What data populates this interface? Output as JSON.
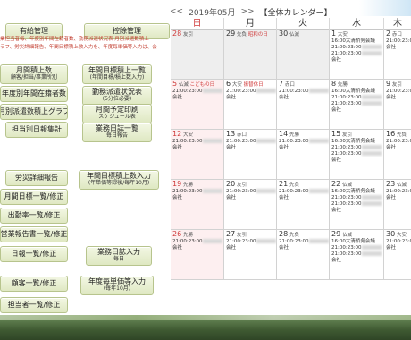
{
  "menu": {
    "top": [
      {
        "label": "有給管理",
        "sub": ""
      },
      {
        "label": "控除管理",
        "sub": ""
      }
    ],
    "notice_lines": [
      "業担当者毎、年度別年間在籍者数、勤務派遣状況表 月別派遣数積上",
      "ラフ、労災詳細報告、年間日標積上数入力を、年度毎単価等入力は、会"
    ],
    "left_column": [
      {
        "label": "月間積上数",
        "sub": "顧客/担当/事業所別"
      },
      {
        "label": "年度別年間在籍者数",
        "sub": ""
      },
      {
        "label": "月別派遣数積上グラフ",
        "sub": ""
      },
      {
        "label": "担当別日報集計",
        "sub": ""
      },
      {
        "label": "労災詳細報告",
        "sub": ""
      },
      {
        "label": "月間日標一覧/修正",
        "sub": ""
      },
      {
        "label": "出勤率一覧/修正",
        "sub": ""
      },
      {
        "label": "営業報告書一覧/修正",
        "sub": ""
      },
      {
        "label": "日報一覧/修正",
        "sub": ""
      },
      {
        "label": "顧客一覧/修正",
        "sub": ""
      },
      {
        "label": "担当者一覧/修正",
        "sub": ""
      }
    ],
    "right_column": [
      {
        "label": "年間目標積上一覧",
        "sub": "(年間目標/積上数入力)"
      },
      {
        "label": "勤務派遣状況表",
        "sub": "(5分位必要)"
      },
      {
        "label": "月間予定印刷",
        "sub": "スケジュール表"
      },
      {
        "label": "業務日誌一覧",
        "sub": "毎日報告"
      },
      {
        "label": "年間目標積上数入力",
        "sub": "(年単価等録後/毎年10月)"
      },
      {
        "label": "業務日誌入力",
        "sub": "毎日"
      },
      {
        "label": "年度毎単価等入力",
        "sub": "(毎年10月)"
      }
    ]
  },
  "calendar": {
    "prev": "<<",
    "next": ">>",
    "year_month": "2019年05月",
    "title": "【全体カレンダー】",
    "weekdays": [
      "日",
      "月",
      "火",
      "水",
      "木"
    ],
    "weeks": [
      [
        {
          "day": "28",
          "rokuyo": "友引",
          "holiday": "",
          "other": true,
          "lines": []
        },
        {
          "day": "29",
          "rokuyo": "先負",
          "holiday": "昭和の日",
          "other": true,
          "lines": []
        },
        {
          "day": "30",
          "rokuyo": "仏滅",
          "holiday": "",
          "other": true,
          "lines": []
        },
        {
          "day": "1",
          "rokuyo": "大安",
          "holiday": "",
          "other": false,
          "lines": [
            "16:00大清桥务会議",
            "21:00:23:00",
            "21:00:23:00",
            "会社"
          ]
        },
        {
          "day": "2",
          "rokuyo": "赤口",
          "holiday": "",
          "other": false,
          "lines": [
            "21:00:23:00",
            "会社"
          ]
        }
      ],
      [
        {
          "day": "5",
          "rokuyo": "仏滅",
          "holiday": "こどもの日",
          "other": false,
          "lines": [
            "21:00:23:00",
            "会社"
          ]
        },
        {
          "day": "6",
          "rokuyo": "大安",
          "holiday": "振替休日",
          "other": false,
          "lines": [
            "21:00:23:00",
            "会社"
          ]
        },
        {
          "day": "7",
          "rokuyo": "赤口",
          "holiday": "",
          "other": false,
          "lines": [
            "21:00:23:00",
            "会社"
          ]
        },
        {
          "day": "8",
          "rokuyo": "先勝",
          "holiday": "",
          "other": false,
          "lines": [
            "16:00大清桥务会議",
            "21:00:23:00",
            "21:00:23:00",
            "会社"
          ]
        },
        {
          "day": "9",
          "rokuyo": "友引",
          "holiday": "",
          "other": false,
          "lines": [
            "21:00:23:00",
            "会社"
          ]
        }
      ],
      [
        {
          "day": "12",
          "rokuyo": "大安",
          "holiday": "",
          "other": false,
          "lines": [
            "21:00:23:00",
            "会社"
          ]
        },
        {
          "day": "13",
          "rokuyo": "赤口",
          "holiday": "",
          "other": false,
          "lines": [
            "21:00:23:00",
            "会社"
          ]
        },
        {
          "day": "14",
          "rokuyo": "先勝",
          "holiday": "",
          "other": false,
          "lines": [
            "21:00:23:00",
            "会社"
          ]
        },
        {
          "day": "15",
          "rokuyo": "友引",
          "holiday": "",
          "other": false,
          "lines": [
            "16:00大清桥务会議",
            "21:00:23:00",
            "21:00:23:00",
            "会社"
          ]
        },
        {
          "day": "16",
          "rokuyo": "先負",
          "holiday": "",
          "other": false,
          "lines": [
            "21:00:23:00",
            "会社"
          ]
        }
      ],
      [
        {
          "day": "19",
          "rokuyo": "先勝",
          "holiday": "",
          "other": false,
          "lines": [
            "21:00:23:00",
            "会社"
          ]
        },
        {
          "day": "20",
          "rokuyo": "友引",
          "holiday": "",
          "other": false,
          "lines": [
            "21:00:23:00",
            "会社"
          ]
        },
        {
          "day": "21",
          "rokuyo": "先負",
          "holiday": "",
          "other": false,
          "lines": [
            "21:00:23:00",
            "会社"
          ]
        },
        {
          "day": "22",
          "rokuyo": "仏滅",
          "holiday": "",
          "other": false,
          "lines": [
            "16:00大清桥务会議",
            "21:00:23:00",
            "21:00:23:00",
            "会社"
          ]
        },
        {
          "day": "23",
          "rokuyo": "仏滅",
          "holiday": "",
          "other": false,
          "lines": [
            "21:00:23:00",
            "会社"
          ]
        }
      ],
      [
        {
          "day": "26",
          "rokuyo": "先勝",
          "holiday": "",
          "other": false,
          "lines": [
            "21:00:23:00",
            "会社"
          ]
        },
        {
          "day": "27",
          "rokuyo": "友引",
          "holiday": "",
          "other": false,
          "lines": [
            "21:00:23:00",
            "会社"
          ]
        },
        {
          "day": "28",
          "rokuyo": "先負",
          "holiday": "",
          "other": false,
          "lines": [
            "21:00:23:00",
            "会社"
          ]
        },
        {
          "day": "29",
          "rokuyo": "仏滅",
          "holiday": "",
          "other": false,
          "lines": [
            "16:00大清桥务会議",
            "21:00:23:00",
            "21:00:23:00",
            "会社"
          ]
        },
        {
          "day": "30",
          "rokuyo": "大安",
          "holiday": "",
          "other": false,
          "lines": [
            "21:00:23:00",
            "会社"
          ]
        }
      ]
    ]
  },
  "colors": {
    "button_bg": "#e6eecf",
    "button_border": "#b7c48d",
    "sunday": "#d03a3a",
    "sunday_bg": "#fdeff0",
    "other_month_bg": "#eeeeee"
  }
}
